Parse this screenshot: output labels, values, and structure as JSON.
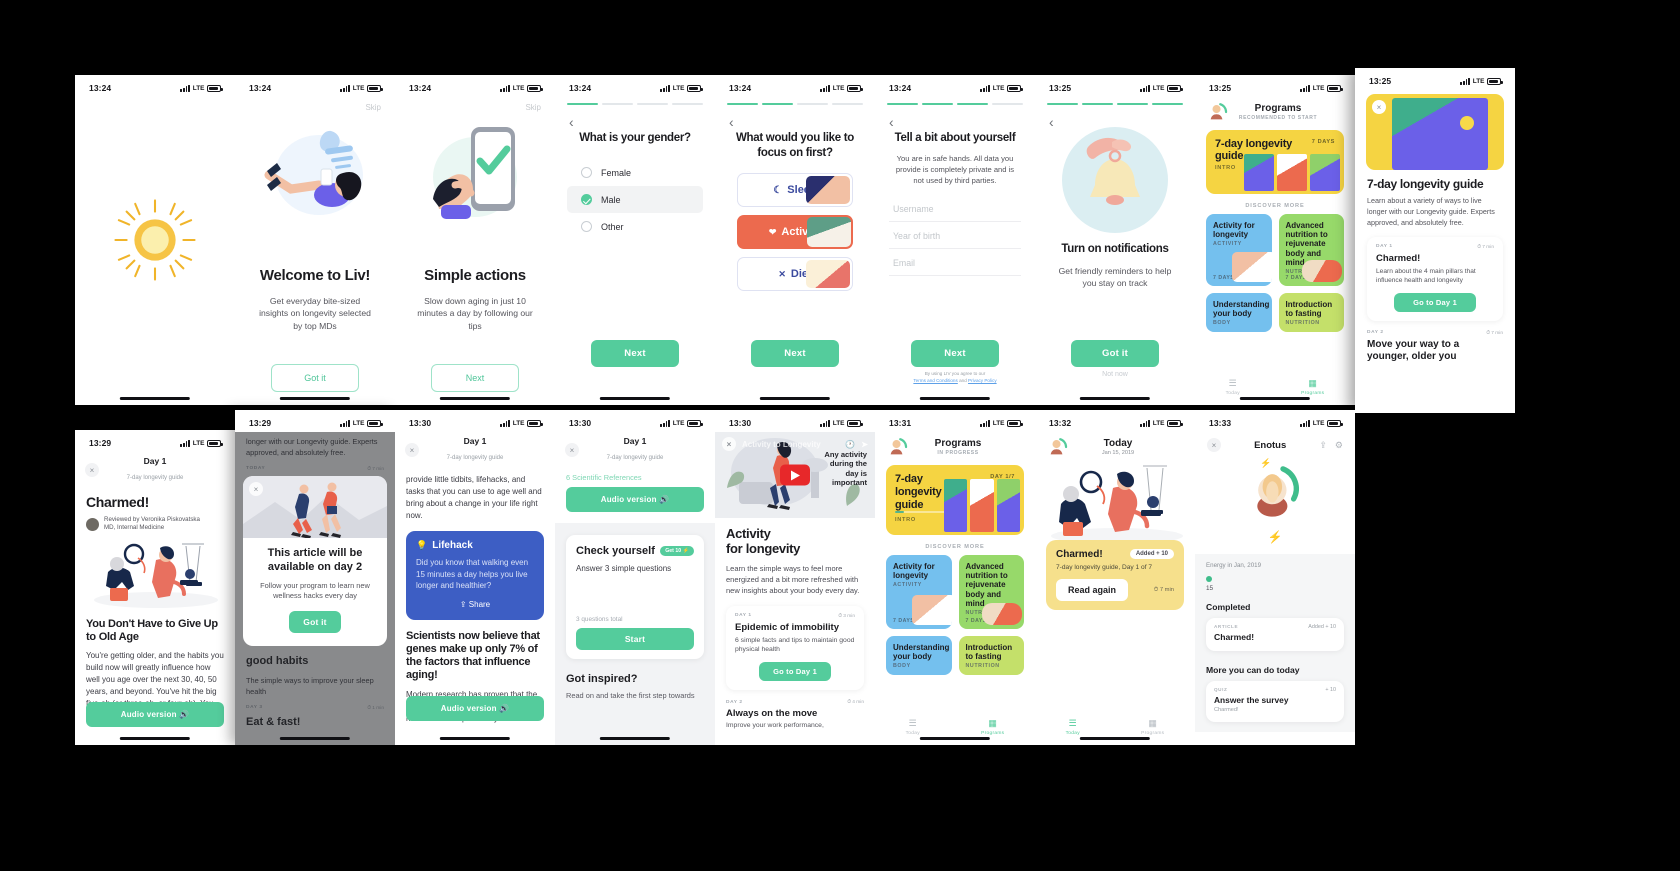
{
  "meta": {
    "background": "#000000",
    "accent": "#54cc9c",
    "app_name": "Liv"
  },
  "screens": [
    {
      "id": "splash",
      "status": {
        "time": "13:24",
        "carrier": "LTE"
      }
    },
    {
      "id": "welcome",
      "status": {
        "time": "13:24",
        "carrier": "LTE"
      },
      "skip": "Skip",
      "title": "Welcome to Liv!",
      "subtitle": "Get everyday bite-sized insights on longevity selected by top MDs",
      "cta": "Got it"
    },
    {
      "id": "simple-actions",
      "status": {
        "time": "13:24",
        "carrier": "LTE"
      },
      "skip": "Skip",
      "title": "Simple actions",
      "subtitle": "Slow down aging in just 10 minutes a day by following our tips",
      "cta": "Next"
    },
    {
      "id": "gender",
      "status": {
        "time": "13:24",
        "carrier": "LTE"
      },
      "back": "‹",
      "title": "What is your gender?",
      "options": [
        {
          "label": "Female",
          "selected": false
        },
        {
          "label": "Male",
          "selected": true
        },
        {
          "label": "Other",
          "selected": false
        }
      ],
      "cta": "Next"
    },
    {
      "id": "focus",
      "status": {
        "time": "13:24",
        "carrier": "LTE"
      },
      "back": "‹",
      "title": "What would you like to focus on first?",
      "cards": [
        {
          "label": "Sleep",
          "icon": "moon-icon",
          "selected": false
        },
        {
          "label": "Activity",
          "icon": "heart-pulse-icon",
          "selected": true
        },
        {
          "label": "Diet",
          "icon": "cutlery-icon",
          "selected": false
        }
      ],
      "cta": "Next"
    },
    {
      "id": "about-you",
      "status": {
        "time": "13:24",
        "carrier": "LTE"
      },
      "back": "‹",
      "title": "Tell a bit about yourself",
      "subtitle": "You are in safe hands. All data you provide is completely private and is not used by third parties.",
      "fields": [
        {
          "placeholder": "Username",
          "value": ""
        },
        {
          "placeholder": "Year of birth",
          "value": ""
        },
        {
          "placeholder": "Email",
          "value": ""
        }
      ],
      "cta": "Next",
      "legal_prefix": "By using LIV you agree to our",
      "legal_link_1": "Terms and Conditions",
      "legal_and": "and",
      "legal_link_2": "Privacy Policy"
    },
    {
      "id": "notifications",
      "status": {
        "time": "13:25",
        "carrier": "LTE"
      },
      "back": "‹",
      "title": "Turn on notifications",
      "subtitle": "Get friendly reminders to help you stay on track",
      "cta": "Got it",
      "secondary": "Not now"
    },
    {
      "id": "programs-recommended",
      "status": {
        "time": "13:25",
        "carrier": "LTE"
      },
      "title": "Programs",
      "subtitle": "RECOMMENDED TO START",
      "hero": {
        "title": "7-day longevity guide",
        "tag": "INTRO",
        "days": "7 DAYS"
      },
      "discover_label": "DISCOVER MORE",
      "cards": [
        {
          "title": "Activity for longevity",
          "tag": "ACTIVITY",
          "days": "7 DAYS",
          "color": "blue"
        },
        {
          "title": "Advanced nutrition to rejuvenate body and mind",
          "tag": "NUTRITION",
          "days": "7 DAYS",
          "color": "green"
        },
        {
          "title": "Understanding your body",
          "tag": "BODY",
          "days": "",
          "color": "blue"
        },
        {
          "title": "Introduction to fasting",
          "tag": "NUTRITION",
          "days": "",
          "color": "green2"
        }
      ],
      "tabs": [
        {
          "label": "Today",
          "icon": "list-icon",
          "active": false
        },
        {
          "label": "Programs",
          "icon": "grid-icon",
          "active": true
        }
      ]
    },
    {
      "id": "program-detail",
      "status": {
        "time": "13:25",
        "carrier": "LTE"
      },
      "close": "×",
      "title": "7-day longevity guide",
      "description": "Learn about a variety of ways to live longer with our Longevity guide. Experts approved, and absolutely free.",
      "days": [
        {
          "label": "DAY 1",
          "time": "7 min",
          "title": "Charmed!",
          "desc": "Learn about the 4 main pillars that influence health and longevity",
          "cta": "Go to Day 1"
        },
        {
          "label": "DAY 2",
          "time": "7 min",
          "title": "Move your way to a younger, older you"
        }
      ]
    },
    {
      "id": "article-charmed",
      "status": {
        "time": "13:29",
        "carrier": "LTE"
      },
      "close": "×",
      "header_title": "Day 1",
      "header_sub": "7-day longevity guide",
      "title": "Charmed!",
      "author": "Reviewed by Veronika Piskovatska",
      "author_sub": "MD, Internal Medicine",
      "section": "You Don't Have to Give Up to Old Age",
      "body": "You're getting older, and the habits you build now will greatly influence how well you age over the next 30, 40, 50 years, and beyond. You've hit the big five-oh (or three-oh, or four-oh). You look at",
      "cta": "Audio version"
    },
    {
      "id": "day2-modal",
      "status": {
        "time": "13:29",
        "carrier": "LTE"
      },
      "bg_text": "longer with our Longevity guide. Experts approved, and absolutely free.",
      "bg_day_label": "TODAY",
      "bg_time": "7 min",
      "modal_title": "This article will be available on day 2",
      "modal_sub": "Follow your program to learn new wellness hacks every day",
      "modal_cta": "Got it",
      "behind_title": "good habits",
      "behind_text": "The simple ways to improve your sleep health",
      "behind_day": "DAY 3",
      "behind_time": "1 min",
      "behind_title2": "Eat & fast!"
    },
    {
      "id": "article-lifehack",
      "status": {
        "time": "13:30",
        "carrier": "LTE"
      },
      "close": "×",
      "header_title": "Day 1",
      "header_sub": "7-day longevity guide",
      "paragraph": "provide little tidbits, lifehacks, and tasks that you can use to age well and bring about a change in your life right now.",
      "lifehack_title": "Lifehack",
      "lifehack_body": "Did you know that walking even 15 minutes a day helps you live longer and healthier?",
      "share": "Share",
      "section": "Scientists now believe that genes make up only 7% of the factors that influence aging!",
      "body": "Modern research has proven that the effect of genes on lifespan is actually much less than previously estimated.",
      "cta": "Audio version"
    },
    {
      "id": "article-quiz",
      "status": {
        "time": "13:30",
        "carrier": "LTE"
      },
      "close": "×",
      "header_title": "Day 1",
      "header_sub": "7-day longevity guide",
      "references": "6 Scientific References",
      "audio_cta": "Audio version",
      "quiz_title": "Check yourself",
      "quiz_badge": "Get 10 ⚡",
      "quiz_sub": "Answer 3 simple questions",
      "quiz_count": "3 questions total",
      "quiz_cta": "Start",
      "next_section": "Got inspired?",
      "next_body": "Read on and take the first step towards"
    },
    {
      "id": "activity-program",
      "status": {
        "time": "13:30",
        "carrier": "LTE"
      },
      "video_title": "Activity to Longevity",
      "video_note": "Any activity during the day is important",
      "title_l1": "Activity",
      "title_l2": "for longevity",
      "description": "Learn the simple ways to feel more energized and a bit more refreshed with new insights about your body every day.",
      "day_label": "DAY 1",
      "day_time": "3 min",
      "day_title": "Epidemic of immobility",
      "day_desc": "6 simple facts and tips to maintain good physical health",
      "day_cta": "Go to Day 1",
      "day2_label": "DAY 2",
      "day2_time": "4 min",
      "day2_title": "Always on the move",
      "day2_desc": "Improve your work performance,"
    },
    {
      "id": "programs-inprogress",
      "status": {
        "time": "13:31",
        "carrier": "LTE"
      },
      "title": "Programs",
      "subtitle": "IN PROGRESS",
      "hero": {
        "title": "7-day longevity guide",
        "tag": "INTRO",
        "days": "DAY 1/7"
      },
      "discover_label": "DISCOVER MORE",
      "cards": [
        {
          "title": "Activity for longevity",
          "tag": "ACTIVITY",
          "days": "7 DAYS",
          "color": "blue"
        },
        {
          "title": "Advanced nutrition to rejuvenate body and mind",
          "tag": "NUTRITION",
          "days": "7 DAYS",
          "color": "green"
        },
        {
          "title": "Understanding your body",
          "tag": "BODY",
          "days": "",
          "color": "blue"
        },
        {
          "title": "Introduction to fasting",
          "tag": "NUTRITION",
          "days": "",
          "color": "green2"
        }
      ],
      "tabs": [
        {
          "label": "Today",
          "icon": "list-icon",
          "active": false
        },
        {
          "label": "Programs",
          "icon": "grid-icon",
          "active": true
        }
      ]
    },
    {
      "id": "today",
      "status": {
        "time": "13:32",
        "carrier": "LTE"
      },
      "title": "Today",
      "date": "Jan 15, 2019",
      "card_title": "Charmed!",
      "card_badge": "Added + 10",
      "card_sub": "7-day longevity guide, Day 1 of 7",
      "card_cta": "Read again",
      "card_time": "7 min",
      "tabs": [
        {
          "label": "Today",
          "icon": "list-icon",
          "active": true
        },
        {
          "label": "Programs",
          "icon": "grid-icon",
          "active": false
        }
      ]
    },
    {
      "id": "profile",
      "status": {
        "time": "13:33",
        "carrier": "LTE"
      },
      "close": "×",
      "title": "Enotus",
      "energy_label": "Energy in Jan, 2019",
      "energy_value": "15",
      "completed_label": "Completed",
      "completed_items": [
        {
          "tag": "ARTICLE",
          "title": "Charmed!",
          "badge": "Added + 10"
        }
      ],
      "more_label": "More you can do today",
      "more_items": [
        {
          "tag": "QUIZ",
          "title": "Answer the survey",
          "sub": "Charmed!",
          "badge": "+ 10"
        }
      ]
    }
  ]
}
